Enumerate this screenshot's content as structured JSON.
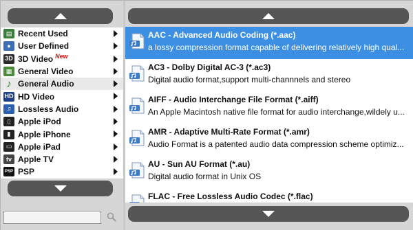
{
  "colors": {
    "scroll_button": "#555555",
    "selection": "#3d8fe3",
    "new_badge": "#e01010"
  },
  "categories": [
    {
      "label": "Recent Used",
      "icon": "recent-icon",
      "selected": false,
      "badge": ""
    },
    {
      "label": "User Defined",
      "icon": "user-icon",
      "selected": false,
      "badge": ""
    },
    {
      "label": "3D Video",
      "icon": "3d-icon",
      "selected": false,
      "badge": "New"
    },
    {
      "label": "General Video",
      "icon": "film-icon",
      "selected": false,
      "badge": ""
    },
    {
      "label": "General Audio",
      "icon": "music-note-icon",
      "selected": true,
      "badge": ""
    },
    {
      "label": "HD Video",
      "icon": "hd-icon",
      "selected": false,
      "badge": ""
    },
    {
      "label": "Lossless Audio",
      "icon": "lossless-audio-icon",
      "selected": false,
      "badge": ""
    },
    {
      "label": "Apple iPod",
      "icon": "ipod-icon",
      "selected": false,
      "badge": ""
    },
    {
      "label": "Apple iPhone",
      "icon": "iphone-icon",
      "selected": false,
      "badge": ""
    },
    {
      "label": "Apple iPad",
      "icon": "ipad-icon",
      "selected": false,
      "badge": ""
    },
    {
      "label": "Apple TV",
      "icon": "apple-tv-icon",
      "selected": false,
      "badge": ""
    },
    {
      "label": "PSP",
      "icon": "psp-icon",
      "selected": false,
      "badge": ""
    }
  ],
  "search": {
    "value": "",
    "placeholder": ""
  },
  "formats": [
    {
      "title": "AAC - Advanced Audio Coding (*.aac)",
      "desc": "a lossy compression format capable of delivering relatively high qual...",
      "selected": true
    },
    {
      "title": "AC3 - Dolby Digital AC-3 (*.ac3)",
      "desc": "Digital audio format,support multi-channnels and stereo",
      "selected": false
    },
    {
      "title": "AIFF - Audio Interchange File Format (*.aiff)",
      "desc": "An Apple Macintosh native file format for audio interchange,wildely u...",
      "selected": false
    },
    {
      "title": "AMR - Adaptive Multi-Rate Format (*.amr)",
      "desc": "Audio Format is a patented audio data compression scheme optimiz...",
      "selected": false
    },
    {
      "title": "AU - Sun AU Format (*.au)",
      "desc": "Digital audio format in Unix OS",
      "selected": false
    },
    {
      "title": "FLAC - Free Lossless Audio Codec (*.flac)",
      "desc": "",
      "selected": false
    }
  ]
}
